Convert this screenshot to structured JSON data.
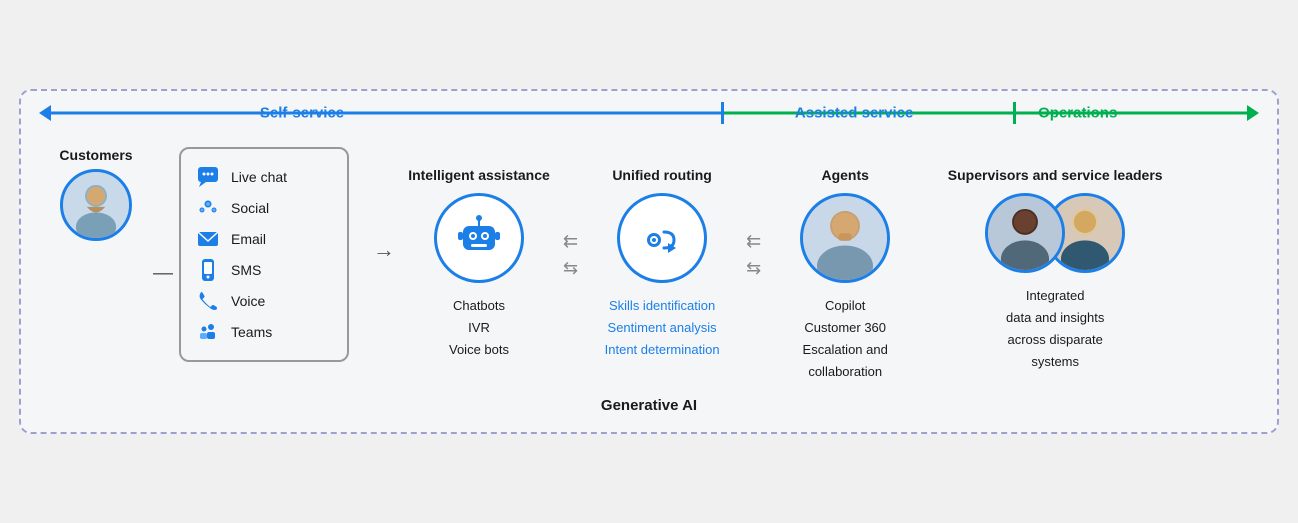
{
  "header": {
    "self_service_label": "Self-service",
    "assisted_service_label": "Assisted service",
    "operations_label": "Operations"
  },
  "customers": {
    "label": "Customers"
  },
  "channels": {
    "items": [
      {
        "icon": "chat",
        "label": "Live chat"
      },
      {
        "icon": "social",
        "label": "Social"
      },
      {
        "icon": "email",
        "label": "Email"
      },
      {
        "icon": "sms",
        "label": "SMS"
      },
      {
        "icon": "voice",
        "label": "Voice"
      },
      {
        "icon": "teams",
        "label": "Teams"
      }
    ]
  },
  "intelligent_assistance": {
    "title": "Intelligent assistance",
    "items": [
      "Chatbots",
      "IVR",
      "Voice bots"
    ]
  },
  "unified_routing": {
    "title": "Unified routing",
    "items": [
      {
        "text": "Skills identification",
        "highlight": true
      },
      {
        "text": "Sentiment analysis",
        "highlight": true
      },
      {
        "text": "Intent determination",
        "highlight": true
      }
    ]
  },
  "agents": {
    "title": "Agents",
    "items": [
      {
        "text": "Copilot",
        "highlight": false
      },
      {
        "text": "Customer 360",
        "highlight": false
      },
      {
        "text": "Escalation and",
        "highlight": false
      },
      {
        "text": "collaboration",
        "highlight": false
      }
    ]
  },
  "supervisors": {
    "title": "Supervisors and service leaders",
    "items": [
      {
        "text": "Integrated",
        "highlight": false
      },
      {
        "text": "data and insights",
        "highlight": false
      },
      {
        "text": "across disparate",
        "highlight": false
      },
      {
        "text": "systems",
        "highlight": false
      }
    ]
  },
  "footer": {
    "label": "Generative AI"
  }
}
